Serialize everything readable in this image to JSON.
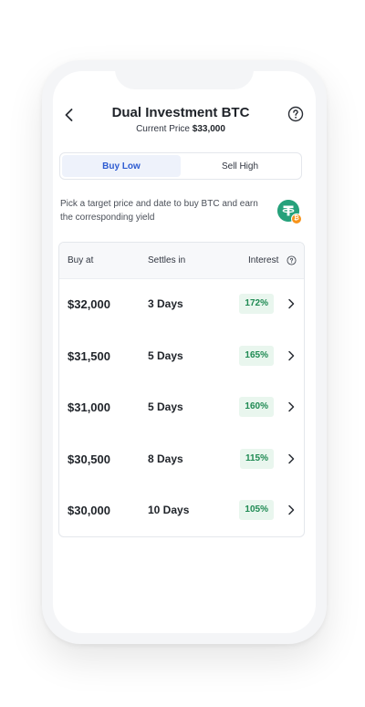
{
  "header": {
    "title": "Dual Investment BTC",
    "price_label": "Current Price",
    "price_value": "$33,000"
  },
  "tabs": [
    {
      "label": "Buy Low",
      "active": true
    },
    {
      "label": "Sell High",
      "active": false
    }
  ],
  "description": "Pick a target price and date to buy BTC and earn the corresponding yield",
  "coin_badge": "₿",
  "table": {
    "headers": {
      "buy_at": "Buy at",
      "settles_in": "Settles in",
      "interest": "Interest"
    },
    "rows": [
      {
        "buy_at": "$32,000",
        "settles_in": "3 Days",
        "interest": "172%"
      },
      {
        "buy_at": "$31,500",
        "settles_in": "5 Days",
        "interest": "165%"
      },
      {
        "buy_at": "$31,000",
        "settles_in": "5 Days",
        "interest": "160%"
      },
      {
        "buy_at": "$30,500",
        "settles_in": "8 Days",
        "interest": "115%"
      },
      {
        "buy_at": "$30,000",
        "settles_in": "10 Days",
        "interest": "105%"
      }
    ]
  },
  "colors": {
    "accent_blue": "#2d5bd1",
    "interest_green": "#1f8a53",
    "tether_green": "#26a17b",
    "btc_orange": "#f7931a"
  },
  "icons": [
    "back-arrow-icon",
    "help-circle-icon",
    "tether-coin-icon",
    "bitcoin-badge-icon",
    "info-icon",
    "chevron-right-icon"
  ]
}
